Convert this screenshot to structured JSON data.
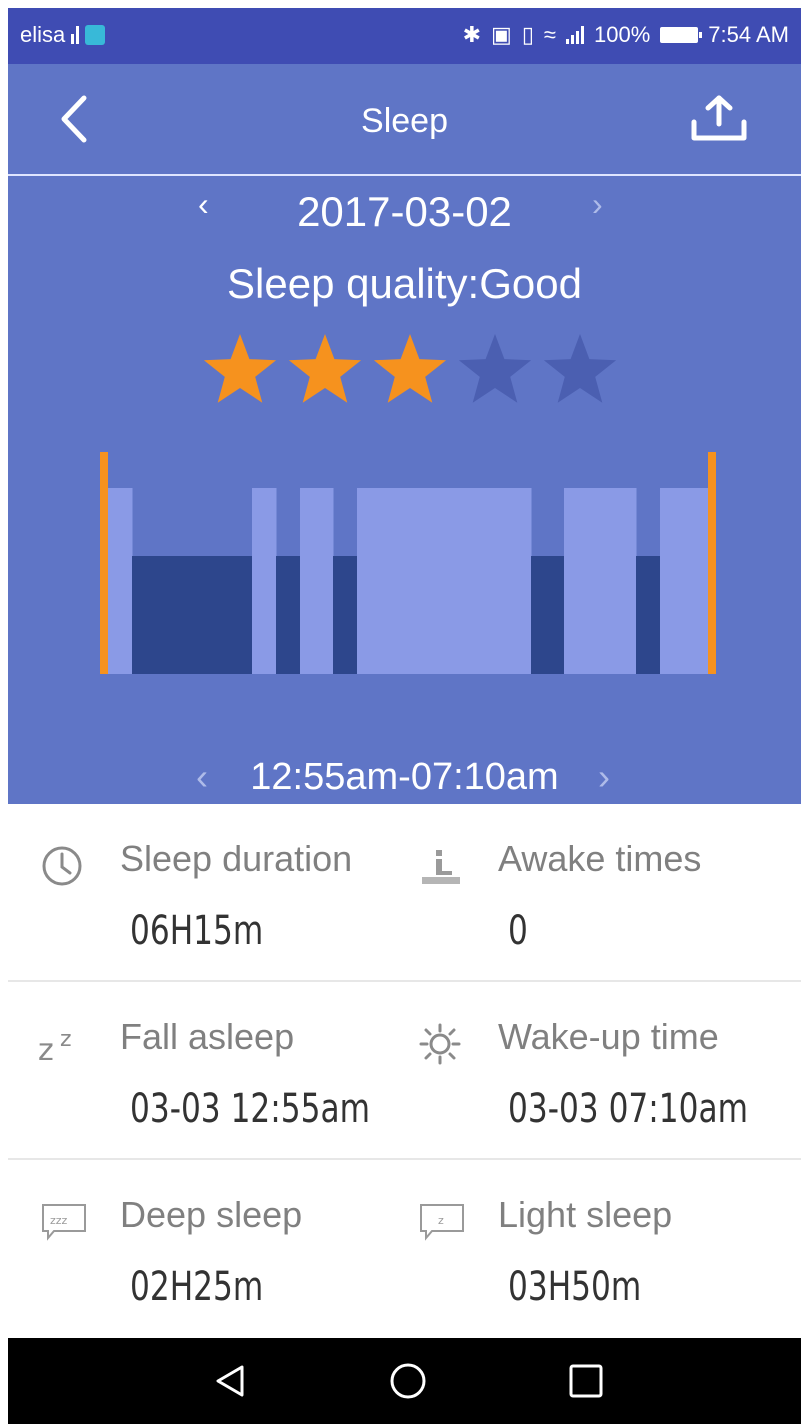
{
  "status_bar": {
    "carrier": "elisa",
    "battery": "100%",
    "time": "7:54 AM",
    "icons": [
      "signal-icon",
      "app-badge-icon",
      "bluetooth-icon",
      "nfc-icon",
      "vibrate-icon",
      "wifi-icon",
      "cell-signal-icon",
      "battery-icon"
    ]
  },
  "header": {
    "title": "Sleep",
    "back_icon": "chevron-left-icon",
    "share_icon": "upload-icon"
  },
  "date_nav": {
    "date": "2017-03-02",
    "prev_icon": "chevron-left-icon",
    "next_icon": "chevron-right-icon"
  },
  "quality": {
    "label": "Sleep quality:Good",
    "rating": 3,
    "max_rating": 5,
    "filled_color": "#f6921e",
    "empty_color": "#4b5fb1"
  },
  "sleep_chart": {
    "colors": {
      "light": "#8a9ae6",
      "deep": "#2d468c",
      "awake_marker": "#f6921e",
      "background": "#5f75c6"
    },
    "segments": [
      {
        "stage": "light",
        "fraction": 0.04
      },
      {
        "stage": "deep",
        "fraction": 0.2
      },
      {
        "stage": "light",
        "fraction": 0.04
      },
      {
        "stage": "deep",
        "fraction": 0.04
      },
      {
        "stage": "light",
        "fraction": 0.055
      },
      {
        "stage": "deep",
        "fraction": 0.04
      },
      {
        "stage": "light",
        "fraction": 0.29
      },
      {
        "stage": "deep",
        "fraction": 0.055
      },
      {
        "stage": "light",
        "fraction": 0.12
      },
      {
        "stage": "deep",
        "fraction": 0.04
      },
      {
        "stage": "light",
        "fraction": 0.08
      }
    ]
  },
  "time_range": {
    "label": "12:55am-07:10am",
    "prev_icon": "chevron-left-icon",
    "next_icon": "chevron-right-icon"
  },
  "stats": [
    {
      "left": {
        "icon": "clock-icon",
        "label": "Sleep duration",
        "value": "06H15m"
      },
      "right": {
        "icon": "awake-person-icon",
        "label": "Awake times",
        "value": "0"
      }
    },
    {
      "left": {
        "icon": "zzz-icon",
        "label": "Fall asleep",
        "value": "03-03 12:55am"
      },
      "right": {
        "icon": "sun-icon",
        "label": "Wake-up time",
        "value": "03-03 07:10am"
      }
    },
    {
      "left": {
        "icon": "deep-sleep-bubble-icon",
        "label": "Deep sleep",
        "value": "02H25m"
      },
      "right": {
        "icon": "light-sleep-bubble-icon",
        "label": "Light sleep",
        "value": "03H50m"
      }
    }
  ],
  "nav_bar": {
    "back": "back-triangle-icon",
    "home": "home-circle-icon",
    "recents": "recents-square-icon"
  }
}
